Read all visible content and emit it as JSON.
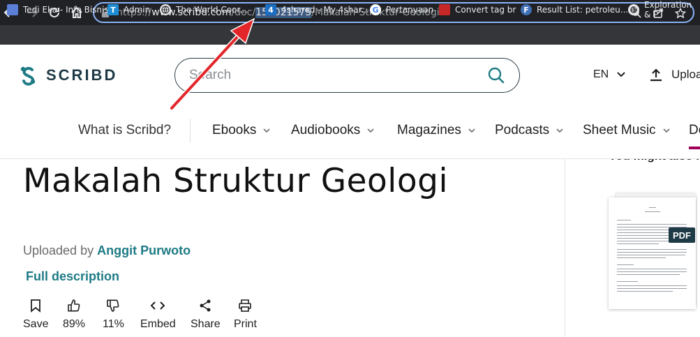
{
  "browser": {
    "url_prefix": "https://",
    "url_host": "www.scribd.com",
    "url_path_before": "/doc/",
    "url_selected": "152021575",
    "url_path_after": "/Makalah-Struktur-Geologi"
  },
  "bookmarks": [
    {
      "label": "Tedi Eka - Info Bisnis",
      "icon": "bookmark-icon",
      "glyph": "",
      "color": "#5b7fd6"
    },
    {
      "label": "Admin",
      "icon": "t-icon",
      "glyph": "T",
      "color": "#1f8dd6"
    },
    {
      "label": "The World Coor...",
      "icon": "globe-icon",
      "glyph": "",
      "color": "#555"
    },
    {
      "label": "4shared - My 4shar...",
      "icon": "4shared-icon",
      "glyph": "4",
      "color": "#1b6ec2"
    },
    {
      "label": "Pertanyaan",
      "icon": "google-icon",
      "glyph": "G",
      "color": "#ffffff"
    },
    {
      "label": "Convert tag br",
      "icon": "convert-icon",
      "glyph": "",
      "color": "#c62828"
    },
    {
      "label": "Result List: petroleu...",
      "icon": "result-icon",
      "glyph": "F",
      "color": "#3f6fb5"
    },
    {
      "label": "Exploration & P",
      "icon": "earth-icon",
      "glyph": "",
      "color": "#e8eaed"
    }
  ],
  "header": {
    "logo_text": "SCRIBD",
    "search_placeholder": "Search",
    "language": "EN",
    "upload_label": "Upload"
  },
  "nav": {
    "what_is": "What is Scribd?",
    "items": [
      "Ebooks",
      "Audiobooks",
      "Magazines",
      "Podcasts",
      "Sheet Music",
      "Do"
    ]
  },
  "document": {
    "title": "Makalah Struktur Geologi",
    "uploaded_by": "Uploaded by",
    "author": "Anggit Purwoto",
    "full_description": "Full description"
  },
  "actions": [
    {
      "label": "Save",
      "icon": "bookmark-icon"
    },
    {
      "label": "89%",
      "icon": "thumbs-up-icon"
    },
    {
      "label": "11%",
      "icon": "thumbs-down-icon"
    },
    {
      "label": "Embed",
      "icon": "embed-icon"
    },
    {
      "label": "Share",
      "icon": "share-icon"
    },
    {
      "label": "Print",
      "icon": "print-icon"
    }
  ],
  "sidebar": {
    "heading": "You might also like",
    "badge": "PDF"
  },
  "colors": {
    "accent_teal": "#1e7b85",
    "nav_underline": "#a1005a",
    "annotation_arrow": "#e3262a"
  }
}
